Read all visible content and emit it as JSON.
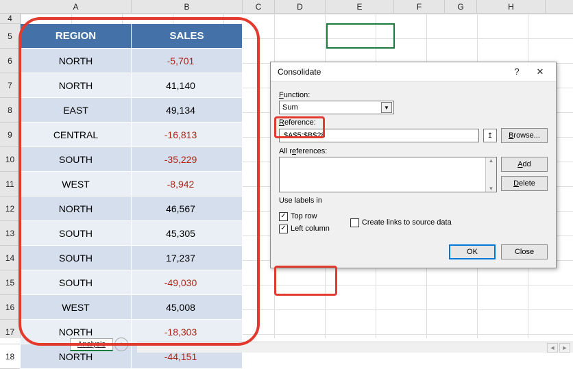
{
  "columns": [
    "A",
    "B",
    "C",
    "D",
    "E",
    "F",
    "G",
    "H"
  ],
  "row_numbers": [
    4,
    5,
    6,
    7,
    8,
    9,
    10,
    11,
    12,
    13,
    14,
    15,
    16,
    17,
    18
  ],
  "table": {
    "headers": {
      "region": "REGION",
      "sales": "SALES"
    },
    "rows": [
      {
        "region": "NORTH",
        "sales": "-5,701",
        "neg": true
      },
      {
        "region": "NORTH",
        "sales": "41,140",
        "neg": false
      },
      {
        "region": "EAST",
        "sales": "49,134",
        "neg": false
      },
      {
        "region": "CENTRAL",
        "sales": "-16,813",
        "neg": true
      },
      {
        "region": "SOUTH",
        "sales": "-35,229",
        "neg": true
      },
      {
        "region": "WEST",
        "sales": "-8,942",
        "neg": true
      },
      {
        "region": "NORTH",
        "sales": "46,567",
        "neg": false
      },
      {
        "region": "SOUTH",
        "sales": "45,305",
        "neg": false
      },
      {
        "region": "SOUTH",
        "sales": "17,237",
        "neg": false
      },
      {
        "region": "SOUTH",
        "sales": "-49,030",
        "neg": true
      },
      {
        "region": "WEST",
        "sales": "45,008",
        "neg": false
      },
      {
        "region": "NORTH",
        "sales": "-18,303",
        "neg": true
      },
      {
        "region": "NORTH",
        "sales": "-44,151",
        "neg": true
      }
    ]
  },
  "dialog": {
    "title": "Consolidate",
    "help_glyph": "?",
    "close_glyph": "✕",
    "function_label": "Function:",
    "function_value": "Sum",
    "reference_label": "Reference:",
    "reference_value": "$A$5:$B$28",
    "collapse_glyph": "↥",
    "browse_label": "Browse...",
    "all_references_label": "All references:",
    "add_label": "Add",
    "delete_label": "Delete",
    "use_labels_label": "Use labels in",
    "top_row_label": "Top row",
    "left_column_label": "Left column",
    "create_links_label": "Create links to source data",
    "ok_label": "OK",
    "close_label": "Close"
  },
  "sheet": {
    "tab_name": "Analysis",
    "add_glyph": "+"
  },
  "colors": {
    "header_bg": "#4472a8",
    "highlight": "#e23a2e",
    "selection": "#1a7a3e"
  }
}
